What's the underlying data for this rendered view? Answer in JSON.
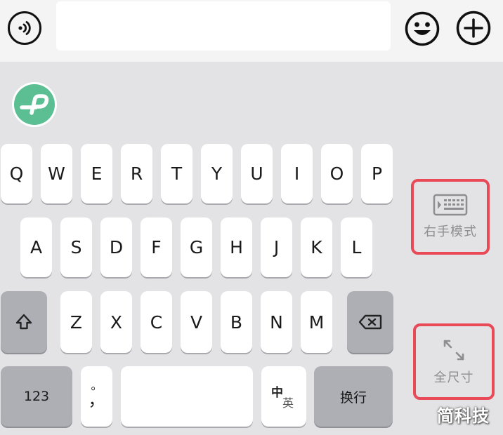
{
  "topbar": {
    "text_value": "",
    "icons": {
      "voice": "voice-wave-icon",
      "emoji": "smiley-icon",
      "add": "plus-circle-icon"
    }
  },
  "keyboard": {
    "logo": "input-method-logo-icon",
    "row1": [
      "Q",
      "W",
      "E",
      "R",
      "T",
      "Y",
      "U",
      "I",
      "O",
      "P"
    ],
    "row2": [
      "A",
      "S",
      "D",
      "F",
      "G",
      "H",
      "J",
      "K",
      "L"
    ],
    "row3": [
      "Z",
      "X",
      "C",
      "V",
      "B",
      "N",
      "M"
    ],
    "shift_icon": "shift-arrow-icon",
    "backspace_icon": "backspace-icon",
    "numbers_label": "123",
    "punct_top": "。",
    "punct_bottom": "，",
    "space_label": "",
    "lang_zh": "中",
    "lang_en": "英",
    "enter_label": "换行"
  },
  "side_panel": {
    "right_hand_label": "右手模式",
    "full_size_label": "全尺寸",
    "highlight_color": "#e84a57"
  },
  "watermark": "简科技",
  "colors": {
    "logo_green": "#5bbf93",
    "func_key": "#adafb5",
    "background": "#e3e3e6"
  }
}
